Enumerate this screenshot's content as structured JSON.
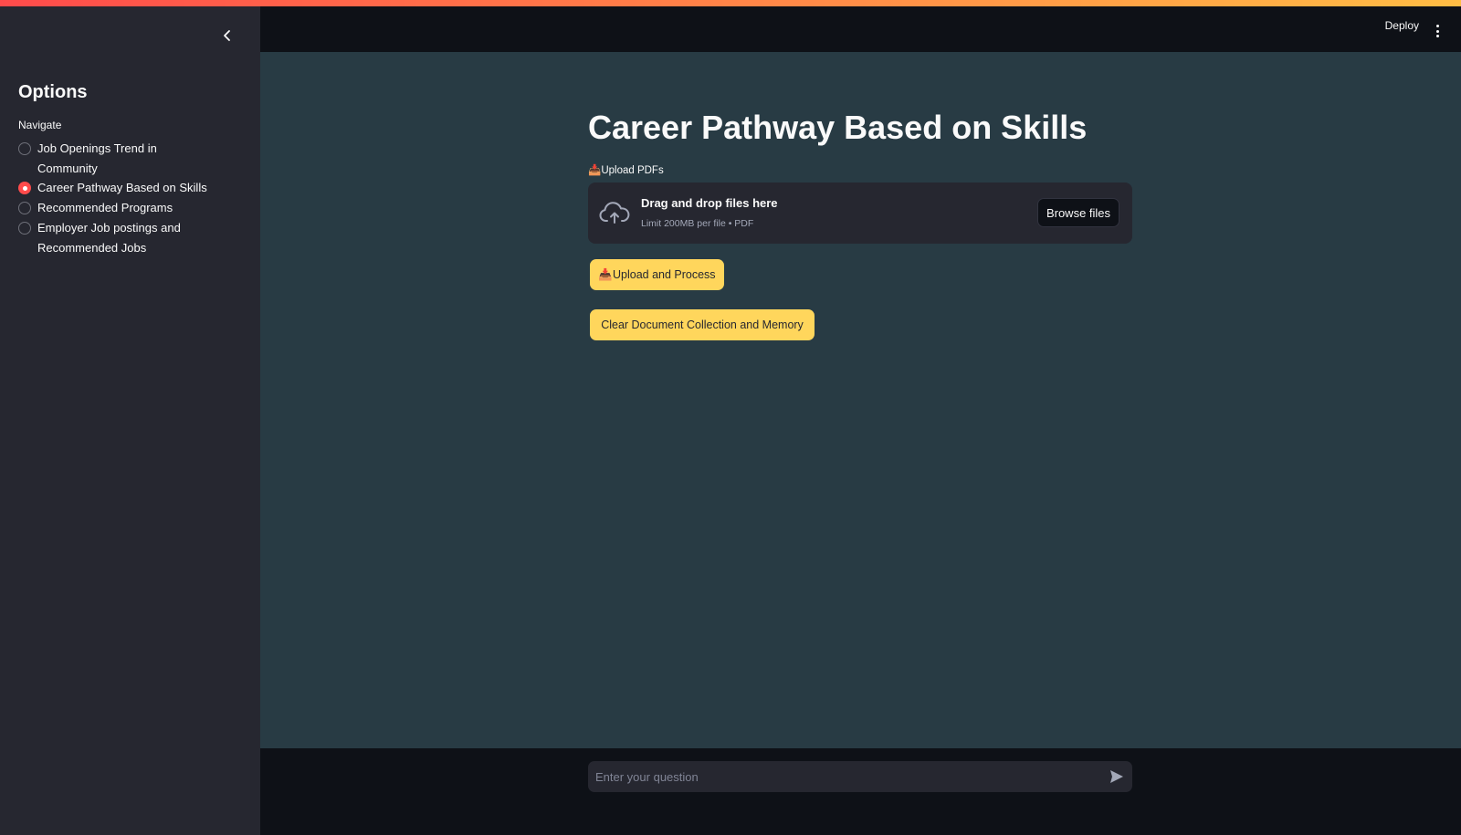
{
  "sidebar": {
    "title": "Options",
    "nav_label": "Navigate",
    "items": [
      {
        "label": "Job Openings Trend in Community",
        "selected": false
      },
      {
        "label": "Career Pathway Based on Skills",
        "selected": true
      },
      {
        "label": "Recommended Programs",
        "selected": false
      },
      {
        "label": "Employer Job postings and Recommended Jobs",
        "selected": false
      }
    ]
  },
  "header": {
    "deploy_label": "Deploy"
  },
  "main": {
    "title": "Career Pathway Based on Skills",
    "upload_label": "📥Upload PDFs",
    "dropzone": {
      "title": "Drag and drop files here",
      "subtitle": "Limit 200MB per file • PDF",
      "browse_label": "Browse files"
    },
    "upload_button_label": "📥Upload and Process",
    "clear_button_label": "Clear Document Collection and Memory"
  },
  "chat": {
    "placeholder": "Enter your question"
  },
  "colors": {
    "accent": "#ff4b4b",
    "button_yellow": "#ffd65c",
    "main_bg": "#283b44",
    "sidebar_bg": "#262730"
  },
  "icons": [
    "chevron-left-icon",
    "kebab-menu-icon",
    "cloud-upload-icon",
    "send-icon"
  ]
}
